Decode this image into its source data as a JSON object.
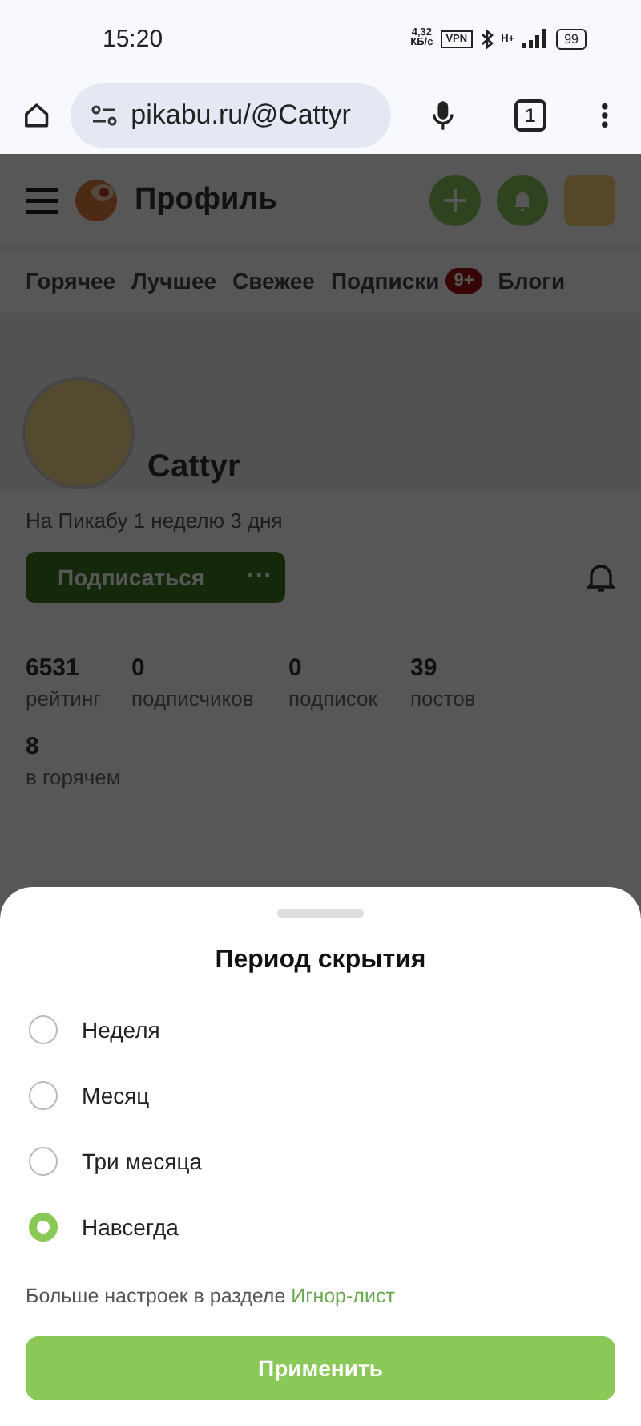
{
  "status_bar": {
    "time": "15:20",
    "speed": "4,32",
    "speed_unit": "КБ/с",
    "vpn": "VPN",
    "network": "H+",
    "battery": "99"
  },
  "browser": {
    "url": "pikabu.ru/@Cattyr",
    "tab_count": "1"
  },
  "header": {
    "title": "Профиль"
  },
  "nav_tabs": [
    {
      "label": "Горячее"
    },
    {
      "label": "Лучшее"
    },
    {
      "label": "Свежее"
    },
    {
      "label": "Подписки",
      "badge": "9+"
    },
    {
      "label": "Блоги"
    }
  ],
  "profile": {
    "name": "Cattyr",
    "since": "На Пикабу 1 неделю 3 дня",
    "subscribe": "Подписаться",
    "more": "···",
    "stats": [
      {
        "value": "6531",
        "label": "рейтинг"
      },
      {
        "value": "0",
        "label": "подписчиков"
      },
      {
        "value": "0",
        "label": "подписок"
      },
      {
        "value": "39",
        "label": "постов"
      },
      {
        "value": "8",
        "label": "в горячем"
      }
    ]
  },
  "sheet": {
    "title": "Период скрытия",
    "options": [
      {
        "label": "Неделя",
        "selected": false
      },
      {
        "label": "Месяц",
        "selected": false
      },
      {
        "label": "Три месяца",
        "selected": false
      },
      {
        "label": "Навсегда",
        "selected": true
      }
    ],
    "hint": "Больше настроек в разделе",
    "hint_link": "Игнор-лист",
    "apply": "Применить"
  }
}
